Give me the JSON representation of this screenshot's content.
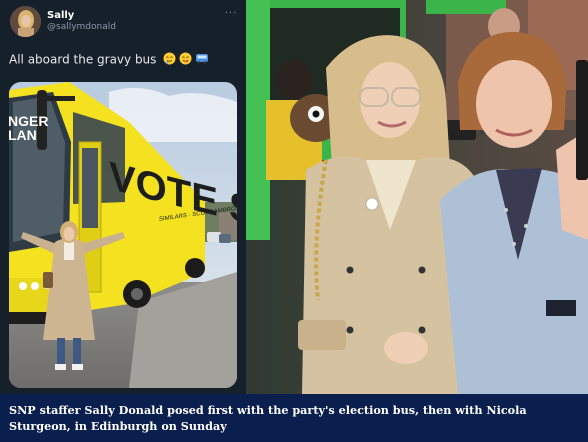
{
  "tweet": {
    "author_name": "Sally",
    "author_handle": "@sallymdonald",
    "text": "All aboard the gravy bus",
    "emojis": [
      "drooling-face",
      "yum-face",
      "bus"
    ],
    "more_label": "···",
    "bus_livery": {
      "slogan": "VOTE SNP",
      "side_text_1": "NGER",
      "side_text_2": "LAN",
      "lower_text": "SIMILARS · SCOTT\nAMBROSE · COLLEEN"
    }
  },
  "caption": {
    "text": "SNP staffer Sally Donald posed first with the party's election bus, then with Nicola Sturgeon, in Edinburgh on Sunday"
  },
  "colors": {
    "tweet_bg": "#15202b",
    "caption_bg": "#0b1f4e",
    "bus_yellow": "#f4e11f",
    "van_green": "#3bb449"
  }
}
